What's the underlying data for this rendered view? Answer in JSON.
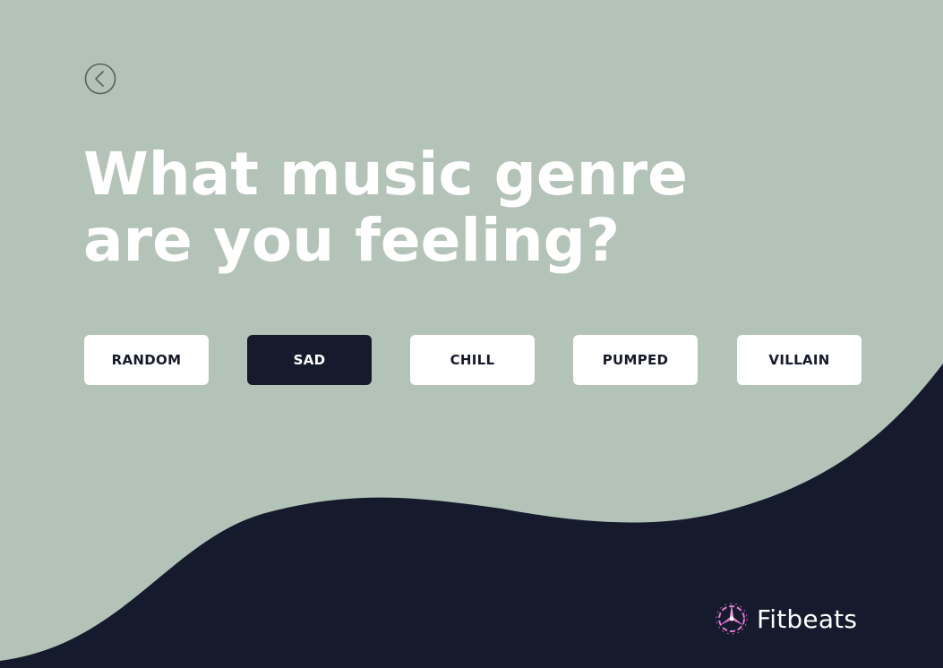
{
  "colors": {
    "background": "#b4c3b8",
    "wave": "#151a2d",
    "button_bg": "#ffffff",
    "button_text": "#161a2c",
    "selected_bg": "#151a2d",
    "selected_text": "#ffffff",
    "logo_accent": "#e07ad0"
  },
  "back": {
    "icon": "chevron-left-circle-icon"
  },
  "heading": {
    "line1": "What music genre",
    "line2": "are you feeling?"
  },
  "genres": [
    {
      "label": "RANDOM",
      "selected": false
    },
    {
      "label": "SAD",
      "selected": true
    },
    {
      "label": "CHILL",
      "selected": false
    },
    {
      "label": "PUMPED",
      "selected": false
    },
    {
      "label": "VILLAIN",
      "selected": false
    }
  ],
  "brand": {
    "name": "Fitbeats",
    "icon": "fitbeats-logo-icon"
  }
}
